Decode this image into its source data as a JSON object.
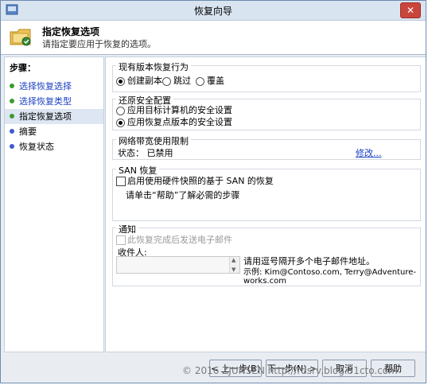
{
  "window": {
    "title": "恢复向导",
    "close_label": "✕"
  },
  "header": {
    "title": "指定恢复选项",
    "description": "请指定要应用于恢复的选项。"
  },
  "steps": {
    "title": "步骤：",
    "items": [
      {
        "label": "选择恢复选择",
        "state": "done"
      },
      {
        "label": "选择恢复类型",
        "state": "done"
      },
      {
        "label": "指定恢复选项",
        "state": "current"
      },
      {
        "label": "摘要",
        "state": "pending"
      },
      {
        "label": "恢复状态",
        "state": "pending"
      }
    ]
  },
  "existing_version": {
    "label": "现有版本恢复行为",
    "options": [
      {
        "label": "创建副本",
        "selected": true
      },
      {
        "label": "跳过",
        "selected": false
      },
      {
        "label": "覆盖",
        "selected": false
      }
    ]
  },
  "security": {
    "label": "还原安全配置",
    "options": [
      {
        "label": "应用目标计算机的安全设置",
        "selected": false
      },
      {
        "label": "应用恢复点版本的安全设置",
        "selected": true
      }
    ]
  },
  "bandwidth": {
    "label": "网络带宽使用限制",
    "status": "状态： 已禁用",
    "modify_link": "修改..."
  },
  "san": {
    "label": "SAN 恢复",
    "checkbox_label": "启用使用硬件快照的基于 SAN 的恢复",
    "help_text": "请单击“帮助”了解必需的步骤"
  },
  "notify": {
    "label": "通知",
    "checkbox_label": "此恢复完成后发送电子邮件",
    "recipients_label": "收件人:",
    "recipients_value": "",
    "hint": "请用逗号隔开多个电子邮件地址。",
    "example": "示例: Kim@Contoso.com, Terry@Adventure-works.com"
  },
  "buttons": {
    "back": "< 上一步(B)",
    "next": "下一步(N) >",
    "cancel": "取消",
    "help": "帮助"
  },
  "watermark": "© 2016 ZJUNSEN http://rdsrv.blog.51cto.com"
}
